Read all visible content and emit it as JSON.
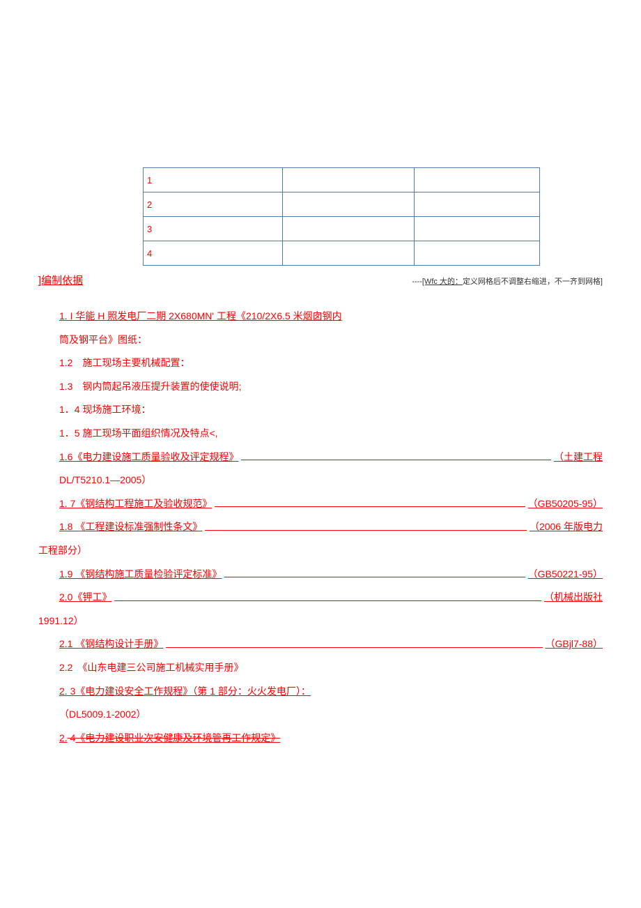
{
  "table": {
    "rows": [
      "1",
      "2",
      "3",
      "4"
    ]
  },
  "heading": "]编制依据",
  "annotation": {
    "dashes": "----",
    "bracket_text": "[Wfc 大的：",
    "trail": "定义网格后不调整右缩进，不一齐到网格]"
  },
  "items": {
    "i1_1a": "1. I 华能 H 照发电厂二期 2X680MN' 工程《210/2X6.5 米烟囱钢内",
    "i1_1b": "筒及钢平台》图纸：",
    "i1_2": "1.2　施工现场主要机械配置：",
    "i1_3": "1.3　钢内筒起吊液压提升装置的使使说明;",
    "i1_4": "1．4 现场施工环境：",
    "i1_5": "1．5 施工现场平面组织情况及特点<,",
    "i1_6_left": "1.6《电力建设施工质量验收及评定规程》",
    "i1_6_right": "（土建工程",
    "i1_6b": "DL/T5210.1—2005）",
    "i1_7_left": "1.  7《钢结构工程施工及验收规范》",
    "i1_7_right": "（GB50205-95）",
    "i1_8_left": "1.8  《工程建设标准强制性条文》",
    "i1_8_right": "（2006 年版电力",
    "i1_8b": "工程部分）",
    "i1_9_left": "1.9  《钢结构施工质量检验评定标准》",
    "i1_9_right": "（GB50221-95）",
    "i2_0_left": "2.0《钾工》",
    "i2_0_right": "（机械出版社",
    "i2_0b": "1991.12）",
    "i2_1_left": "2.1  《钢结构设计手册》",
    "i2_1_right": "（GBjl7-88）",
    "i2_2": "2.2　《山东电建三公司施工机械实用手册》",
    "i2_3a": "2.  3《电力建设安全工作规程》（第 1 部分：火火发电厂）：",
    "i2_3b": "（DL5009.1-2002）",
    "i2_4_num": "2.",
    "i2_4_sub": "  4",
    "i2_4_text": "《电力建设职业次安健康及环境管再工作规定》"
  }
}
